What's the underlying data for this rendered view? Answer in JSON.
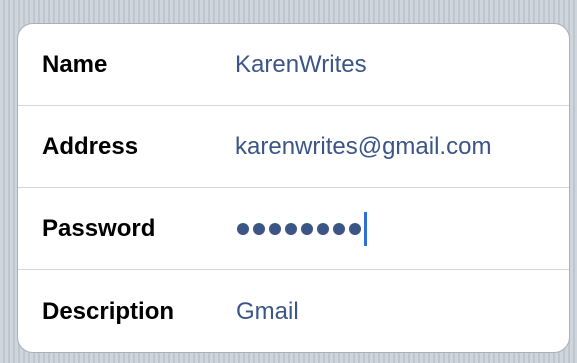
{
  "account_form": {
    "rows": [
      {
        "label": "Name",
        "value": "KarenWrites"
      },
      {
        "label": "Address",
        "value": "karenwrites@gmail.com"
      },
      {
        "label": "Password",
        "value_masked_length": 8
      },
      {
        "label": "Description",
        "value": "Gmail"
      }
    ]
  },
  "colors": {
    "background": "#c5ccd4",
    "card": "#ffffff",
    "label_text": "#000000",
    "value_text": "#3b5586",
    "caret": "#2f6fd6",
    "divider": "#d7d7d7"
  }
}
